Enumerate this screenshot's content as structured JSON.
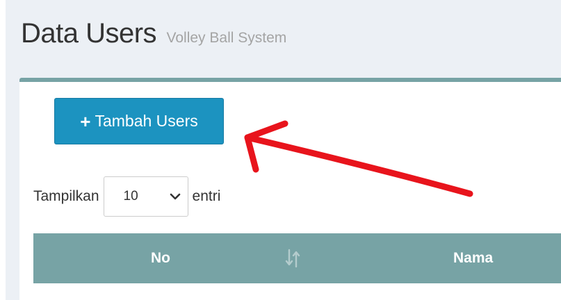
{
  "header": {
    "title": "Data Users",
    "subtitle": "Volley Ball System"
  },
  "toolbar": {
    "add_button_label": "Tambah Users",
    "add_button_icon": "plus-icon"
  },
  "length_menu": {
    "prefix": "Tampilkan",
    "selected": "10",
    "suffix": "entri"
  },
  "table": {
    "columns": [
      "No",
      "Nama"
    ]
  },
  "colors": {
    "accent": "#77a3a5",
    "button": "#1c93c0",
    "annotation_arrow": "#e8141c"
  }
}
